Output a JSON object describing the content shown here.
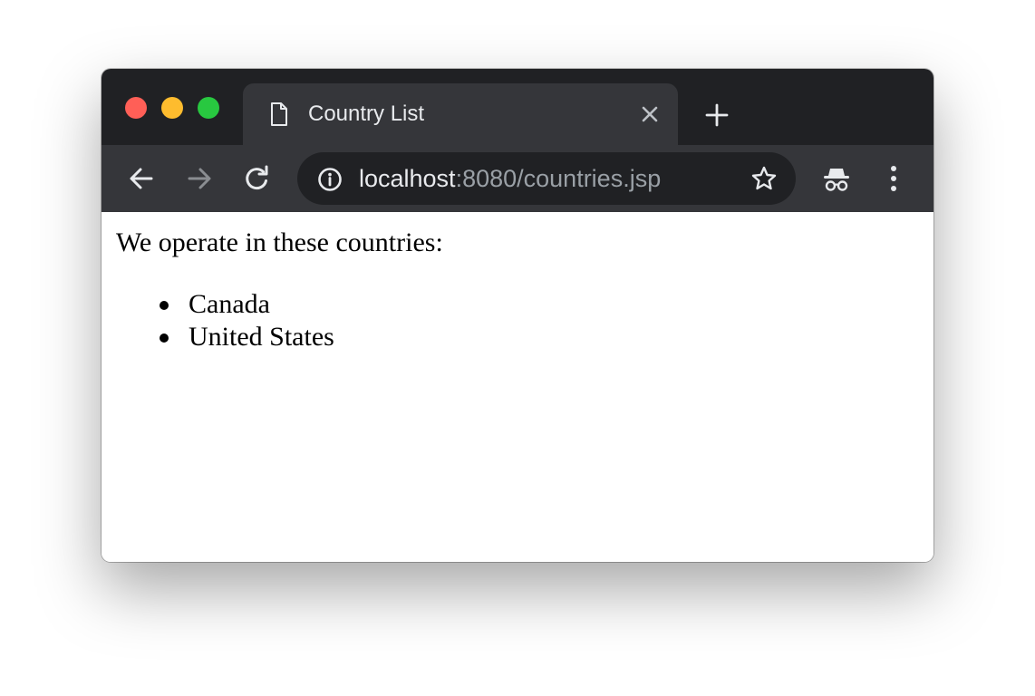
{
  "window": {
    "traffic_lights": {
      "close_color": "#ff5f57",
      "minimize_color": "#febc2e",
      "maximize_color": "#28c840"
    }
  },
  "tab": {
    "title": "Country List",
    "favicon": "document-icon",
    "close_icon": "close-icon",
    "new_tab_icon": "plus-icon"
  },
  "toolbar": {
    "back_icon": "arrow-left-icon",
    "forward_icon": "arrow-right-icon",
    "reload_icon": "reload-icon",
    "info_icon": "info-icon",
    "bookmark_icon": "star-icon",
    "incognito_icon": "incognito-icon",
    "menu_icon": "kebab-menu-icon",
    "url_host": "localhost",
    "url_rest": ":8080/countries.jsp"
  },
  "page": {
    "intro": "We operate in these countries:",
    "countries": [
      "Canada",
      "United States"
    ]
  },
  "colors": {
    "tabstrip_bg": "#202124",
    "toolbar_bg": "#35363a",
    "omnibox_bg": "#202124",
    "text_light": "#e8eaed",
    "text_muted": "#9aa0a6"
  }
}
